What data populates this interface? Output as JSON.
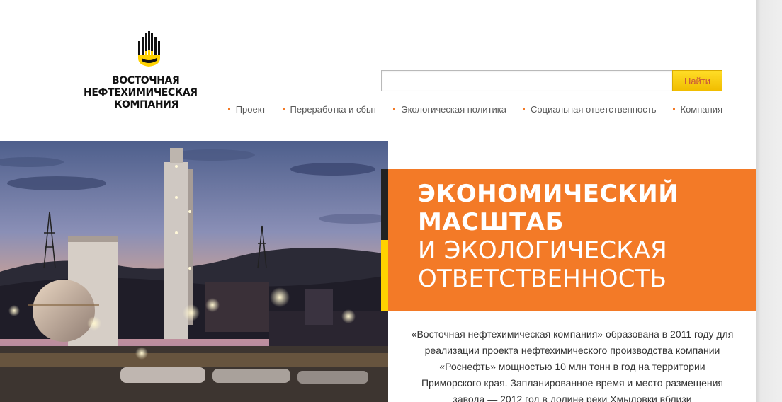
{
  "logo": {
    "line1": "ВОСТОЧНАЯ",
    "line2": "НЕФТЕХИМИЧЕСКАЯ",
    "line3": "КОМПАНИЯ",
    "icon": "rosneft-flame-icon",
    "colors": {
      "black": "#111111",
      "yellow": "#ffd200"
    }
  },
  "search": {
    "value": "",
    "button_label": "Найти"
  },
  "nav": {
    "items": [
      {
        "label": "Проект"
      },
      {
        "label": "Переработка и сбыт"
      },
      {
        "label": "Экологическая политика"
      },
      {
        "label": "Социальная ответственность"
      },
      {
        "label": "Компания"
      }
    ],
    "bullet_color": "#f47a25"
  },
  "banner": {
    "line1": "ЭКОНОМИЧЕСКИЙ",
    "line2": "МАСШТАБ",
    "line3": "И ЭКОЛОГИЧЕСКАЯ",
    "line4": "ОТВЕТСТВЕННОСТЬ",
    "background_color": "#f37a27"
  },
  "intro": {
    "text": "«Восточная нефтехимическая компания» образована в 2011 году для реализации проекта нефтехимического производства компании «Роснефть» мощностью 10 млн тонн в год на территории Приморского края. Запланированное время и место размещения завода — 2012 год в долине реки Хмыловки вблизи"
  },
  "hero": {
    "image": "refinery-at-dusk-photo"
  }
}
